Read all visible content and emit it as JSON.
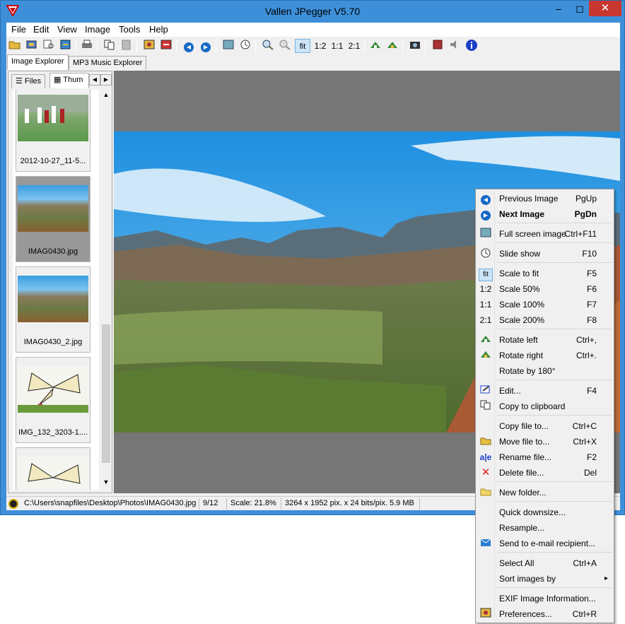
{
  "window": {
    "title": "Vallen JPegger V5.70",
    "min_glyph": "–",
    "max_glyph": "◻",
    "close_glyph": "✕"
  },
  "menubar": [
    "File",
    "Edit",
    "View",
    "Image",
    "Tools",
    "Help"
  ],
  "toolbar": {
    "fit": "fit",
    "scale_50": "1:2",
    "scale_100": "1:1",
    "scale_200": "2:1"
  },
  "tabs": {
    "image_explorer": "Image Explorer",
    "mp3_explorer": "MP3 Music Explorer",
    "files": "Files",
    "thumbnails": "Thum"
  },
  "thumbnails": [
    {
      "caption": "2012-10-27_11-5..."
    },
    {
      "caption": "IMAG0430.jpg",
      "selected": true
    },
    {
      "caption": "IMAG0430_2.jpg"
    },
    {
      "caption": "IMG_132_3203-1...."
    },
    {
      "caption": ""
    }
  ],
  "statusbar": {
    "path": "C:\\Users\\snapfiles\\Desktop\\Photos\\IMAG0430.jpg",
    "index": "9/12",
    "scale": "Scale: 21.8%",
    "dimensions": "3264 x 1952 pix. x 24 bits/pix.  5.9 MB"
  },
  "context_menu": {
    "items": [
      {
        "label": "Previous Image",
        "shortcut": "PgUp",
        "icon": "previous-icon"
      },
      {
        "label": "Next Image",
        "shortcut": "PgDn",
        "icon": "next-icon",
        "bold": true
      },
      {
        "label": "Full screen image",
        "shortcut": "Ctrl+F11",
        "icon": "fullscreen-icon"
      },
      {
        "label": "Slide show",
        "shortcut": "F10",
        "icon": "slideshow-icon"
      },
      {
        "label": "Scale to fit",
        "shortcut": "F5",
        "icon": "fit-icon"
      },
      {
        "label": "Scale 50%",
        "shortcut": "F6",
        "icon": "scale-50-icon"
      },
      {
        "label": "Scale 100%",
        "shortcut": "F7",
        "icon": "scale-100-icon"
      },
      {
        "label": "Scale 200%",
        "shortcut": "F8",
        "icon": "scale-200-icon"
      },
      {
        "label": "Rotate left",
        "shortcut": "Ctrl+,",
        "icon": "rotate-left-icon"
      },
      {
        "label": "Rotate right",
        "shortcut": "Ctrl+.",
        "icon": "rotate-right-icon"
      },
      {
        "label": "Rotate by 180°",
        "shortcut": "",
        "icon": ""
      },
      {
        "label": "Edit...",
        "shortcut": "F4",
        "icon": "edit-icon"
      },
      {
        "label": "Copy to clipboard",
        "shortcut": "",
        "icon": "copy-icon"
      },
      {
        "label": "Copy file to...",
        "shortcut": "Ctrl+C",
        "icon": ""
      },
      {
        "label": "Move file to...",
        "shortcut": "Ctrl+X",
        "icon": "move-file-icon"
      },
      {
        "label": "Rename file...",
        "shortcut": "F2",
        "icon": "rename-icon"
      },
      {
        "label": "Delete file...",
        "shortcut": "Del",
        "icon": "delete-icon"
      },
      {
        "label": "New folder...",
        "shortcut": "",
        "icon": "new-folder-icon"
      },
      {
        "label": "Quick downsize...",
        "shortcut": "",
        "icon": ""
      },
      {
        "label": "Resample...",
        "shortcut": "",
        "icon": ""
      },
      {
        "label": "Send to e-mail recipient...",
        "shortcut": "",
        "icon": "email-icon"
      },
      {
        "label": "Select All",
        "shortcut": "Ctrl+A",
        "icon": ""
      },
      {
        "label": "Sort images by",
        "shortcut": "▸",
        "icon": ""
      },
      {
        "label": "EXIF Image Information...",
        "shortcut": "",
        "icon": ""
      },
      {
        "label": "Preferences...",
        "shortcut": "Ctrl+R",
        "icon": "preferences-icon"
      }
    ]
  }
}
